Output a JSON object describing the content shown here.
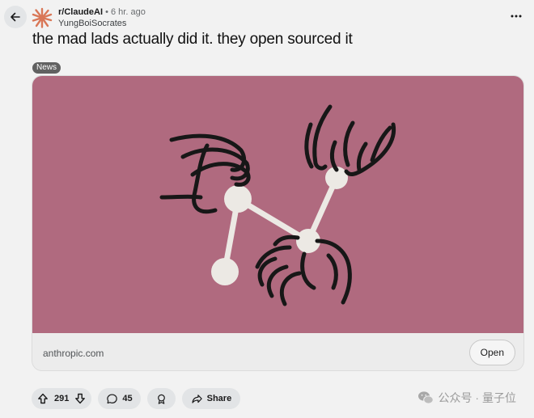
{
  "post": {
    "subreddit": "r/ClaudeAI",
    "separator": "•",
    "time": "6 hr. ago",
    "author": "YungBoiSocrates",
    "title": "the mad lads actually did it. they open sourced it",
    "flair": "News"
  },
  "link_card": {
    "domain": "anthropic.com",
    "open_label": "Open",
    "image_bg": "#b06a7f"
  },
  "actions": {
    "upvotes": "291",
    "comments": "45",
    "share_label": "Share"
  },
  "watermark": {
    "text": "公众号 · 量子位"
  },
  "colors": {
    "subreddit_icon": "#d97757",
    "pill_bg": "#e2e4e6",
    "page_bg": "#f2f2f2"
  },
  "icons": {
    "back": "arrow-left-icon",
    "subreddit": "sunburst-icon",
    "more": "more-horizontal-icon",
    "upvote": "arrow-up-icon",
    "downvote": "arrow-down-icon",
    "comment": "comment-bubble-icon",
    "award": "award-icon",
    "share": "share-arrow-icon",
    "watermark": "wechat-icon"
  }
}
